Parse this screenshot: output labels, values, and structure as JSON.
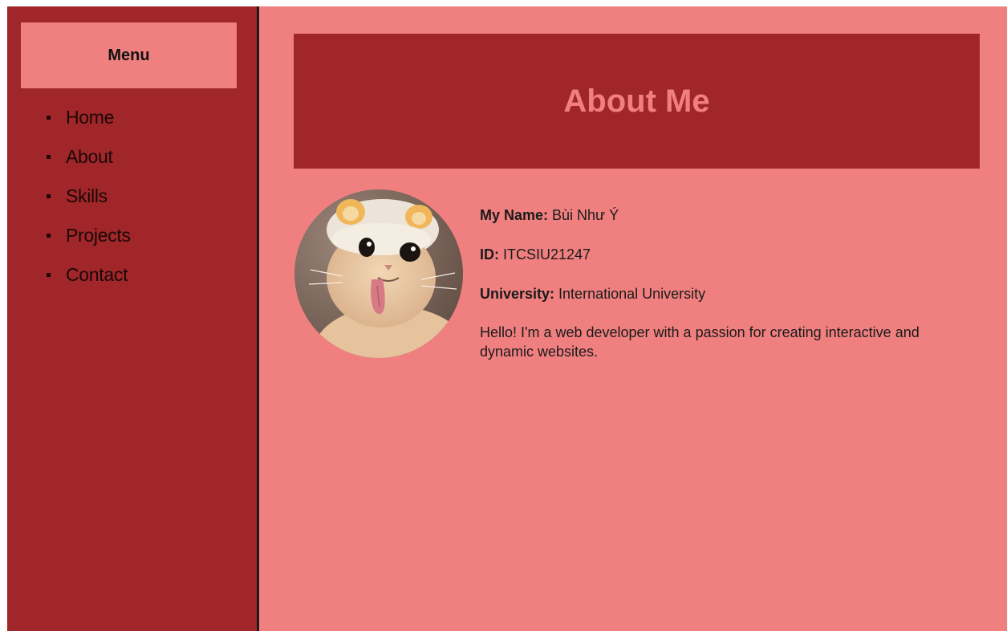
{
  "sidebar": {
    "menu_title": "Menu",
    "items": [
      {
        "label": "Home"
      },
      {
        "label": "About"
      },
      {
        "label": "Skills"
      },
      {
        "label": "Projects"
      },
      {
        "label": "Contact"
      }
    ]
  },
  "main": {
    "title": "About Me",
    "profile": {
      "avatar_icon": "cat-photo",
      "name_label": "My Name:",
      "name_value": " Bùi Như Ý",
      "id_label": "ID:",
      "id_value": " ITCSIU21247",
      "university_label": "University:",
      "university_value": " International University",
      "bio": "Hello! I'm a web developer with a passion for creating interactive and dynamic websites."
    }
  },
  "colors": {
    "sidebar_bg": "#a12629",
    "main_bg": "#f08080",
    "banner_bg": "#a12629",
    "title_color": "#f08080"
  }
}
